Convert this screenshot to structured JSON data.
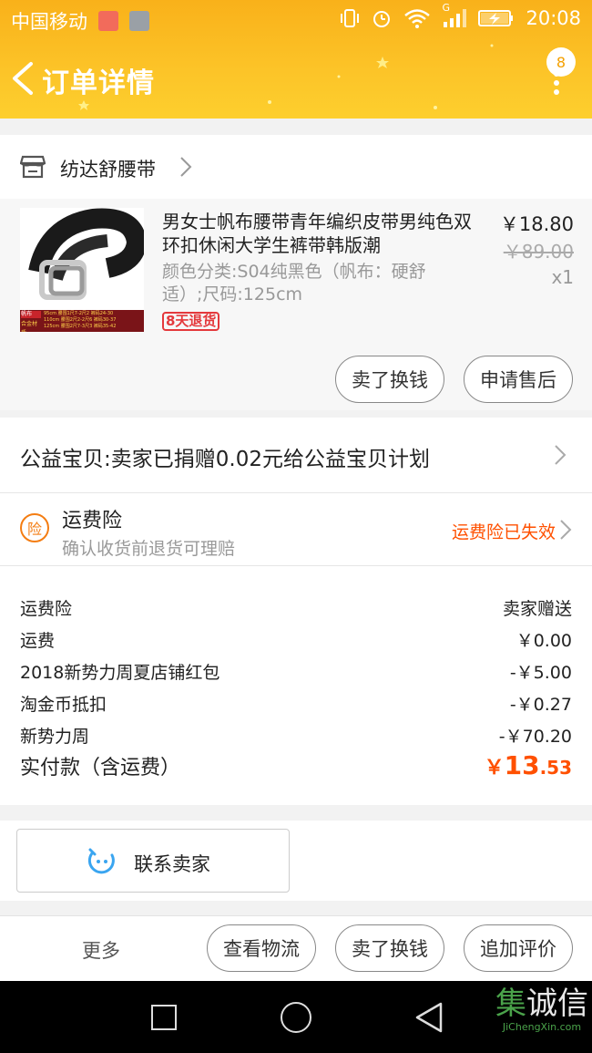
{
  "status_bar": {
    "carrier": "中国移动",
    "network": "G",
    "time": "20:08"
  },
  "nav": {
    "title": "订单详情",
    "badge_count": "8"
  },
  "shop": {
    "name": "纺达舒腰带"
  },
  "product": {
    "title": "男女士帆布腰带青年编织皮带男纯色双环扣休闲大学生裤带韩版潮",
    "sku": "颜色分类:S04纯黑色（帆布：硬舒适）;尺码:125cm",
    "tag": "8天退货",
    "price": "￥18.80",
    "original_price": "￥89.00",
    "quantity": "x1",
    "thumb_text": {
      "label1": "帆布",
      "label2": "合金材质",
      "rows": [
        "95cm 腰围1尺7-2尺2 裤码24-30",
        "110cm 腰围2尺2-2尺6 裤码30-37",
        "125cm 腰围2尺7-3尺3 裤码35-42"
      ]
    },
    "btn_sell": "卖了换钱",
    "btn_aftersale": "申请售后"
  },
  "charity": {
    "text": "公益宝贝:卖家已捐赠0.02元给公益宝贝计划"
  },
  "insurance": {
    "icon_char": "险",
    "title": "运费险",
    "subtitle": "确认收货前退货可理赔",
    "status": "运费险已失效"
  },
  "fees": [
    {
      "label": "运费险",
      "value": "卖家赠送"
    },
    {
      "label": "运费",
      "value": "￥0.00"
    },
    {
      "label": "2018新势力周夏店铺红包",
      "value": "-￥5.00"
    },
    {
      "label": "淘金币抵扣",
      "value": "-￥0.27"
    },
    {
      "label": "新势力周",
      "value": "-￥70.20"
    }
  ],
  "total": {
    "label": "实付款（含运费）",
    "currency": "￥",
    "integer": "13",
    "decimal": ".53"
  },
  "contact": {
    "label": "联系卖家"
  },
  "actions": {
    "more": "更多",
    "logistics": "查看物流",
    "sell": "卖了换钱",
    "review": "追加评价"
  },
  "watermark": {
    "logo_char1": "集",
    "logo_char2": "诚信",
    "url": "JiChengXin.com"
  },
  "colors": {
    "header_yellow": "#fcc428",
    "price_orange": "#ff5000",
    "accent_blue": "#3aa5f0"
  }
}
